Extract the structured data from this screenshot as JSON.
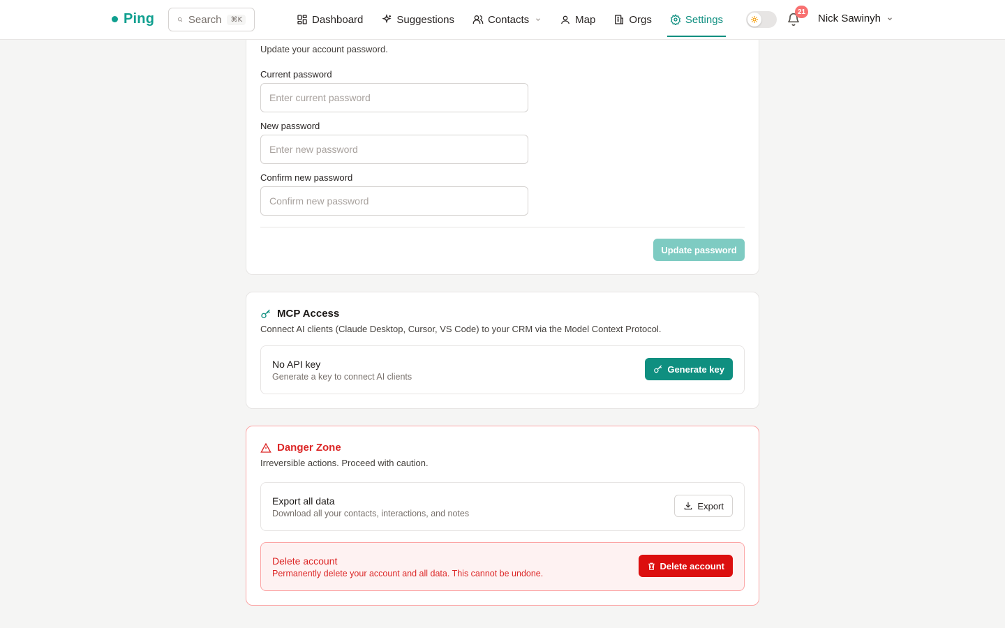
{
  "header": {
    "logo": "Ping",
    "search_label": "Search",
    "search_shortcut": "⌘K",
    "nav": [
      {
        "label": "Dashboard",
        "icon": "dashboard-icon"
      },
      {
        "label": "Suggestions",
        "icon": "sparkles-icon"
      },
      {
        "label": "Contacts",
        "icon": "users-icon",
        "dropdown": true
      },
      {
        "label": "Map",
        "icon": "map-pin-icon"
      },
      {
        "label": "Orgs",
        "icon": "building-icon"
      },
      {
        "label": "Settings",
        "icon": "gear-icon",
        "active": true
      }
    ],
    "notification_count": "21",
    "user_name": "Nick Sawinyh",
    "accent_color": "#0f8f80"
  },
  "password": {
    "description": "Update your account password.",
    "current_label": "Current password",
    "current_placeholder": "Enter current password",
    "new_label": "New password",
    "new_placeholder": "Enter new password",
    "confirm_label": "Confirm new password",
    "confirm_placeholder": "Confirm new password",
    "submit_label": "Update password"
  },
  "mcp": {
    "title": "MCP Access",
    "description": "Connect AI clients (Claude Desktop, Cursor, VS Code) to your CRM via the Model Context Protocol.",
    "status_title": "No API key",
    "status_sub": "Generate a key to connect AI clients",
    "generate_label": "Generate key"
  },
  "danger": {
    "title": "Danger Zone",
    "description": "Irreversible actions. Proceed with caution.",
    "export_title": "Export all data",
    "export_sub": "Download all your contacts, interactions, and notes",
    "export_label": "Export",
    "delete_title": "Delete account",
    "delete_sub": "Permanently delete your account and all data. This cannot be undone.",
    "delete_label": "Delete account",
    "danger_color": "#dc2626"
  }
}
